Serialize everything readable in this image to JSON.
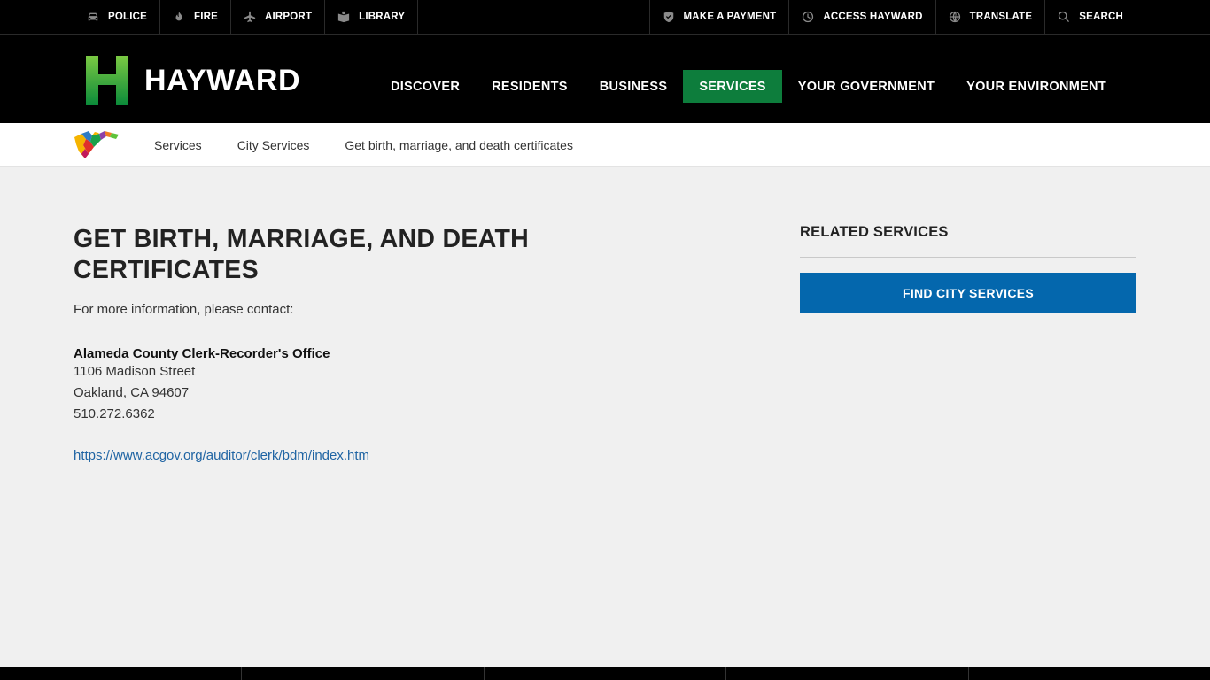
{
  "utility": {
    "left": [
      {
        "label": "POLICE",
        "icon": "police-car-icon"
      },
      {
        "label": "FIRE",
        "icon": "flame-icon"
      },
      {
        "label": "AIRPORT",
        "icon": "airplane-icon"
      },
      {
        "label": "LIBRARY",
        "icon": "book-icon"
      }
    ],
    "right": [
      {
        "label": "MAKE A PAYMENT",
        "icon": "shield-check-icon"
      },
      {
        "label": "ACCESS HAYWARD",
        "icon": "clock-icon"
      },
      {
        "label": "TRANSLATE",
        "icon": "globe-icon"
      },
      {
        "label": "SEARCH",
        "icon": "search-icon"
      }
    ]
  },
  "header": {
    "logo_text": "HAYWARD",
    "nav": [
      {
        "label": "DISCOVER"
      },
      {
        "label": "RESIDENTS"
      },
      {
        "label": "BUSINESS"
      },
      {
        "label": "SERVICES"
      },
      {
        "label": "YOUR GOVERNMENT"
      },
      {
        "label": "YOUR ENVIRONMENT"
      }
    ],
    "active_nav": "SERVICES"
  },
  "breadcrumb": [
    {
      "label": "Services"
    },
    {
      "label": "City Services"
    },
    {
      "label": "Get birth, marriage, and death certificates"
    }
  ],
  "main": {
    "title": "GET BIRTH, MARRIAGE, AND DEATH CERTIFICATES",
    "intro": "For more information, please contact:",
    "office_name": "Alameda County Clerk-Recorder's Office",
    "address_line1": "1106 Madison Street",
    "address_line2": "Oakland, CA 94607",
    "phone": "510.272.6362",
    "link": "https://www.acgov.org/auditor/clerk/bdm/index.htm"
  },
  "sidebar": {
    "heading": "RELATED SERVICES",
    "button": "FIND CITY SERVICES"
  },
  "colors": {
    "accent_green": "#0d7d3c",
    "button_blue": "#0467ad",
    "link_blue": "#1f64a3",
    "background": "#f0f0f0"
  }
}
